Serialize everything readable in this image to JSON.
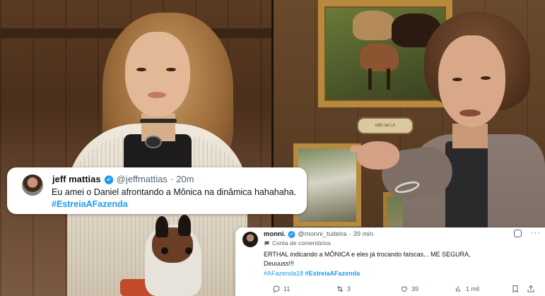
{
  "tweet_primary": {
    "display_name": "jeff mattias",
    "handle": "@jeffmattias",
    "separator": "·",
    "time": "20m",
    "text": "Eu amei o Daniel afrontando a Mônica na dinâmica hahahaha.",
    "hashtag": "#EstreiaAFazenda",
    "verified_color": "#1d9bf0"
  },
  "tweet_secondary": {
    "display_name": "monni.",
    "handle": "@monni_tuiteira",
    "separator": "·",
    "time": "39 min",
    "community_label": "Conta de comentários",
    "text_line1": "ERTHAL indicando a MÔNICA e eles já trocando faíscas... ME SEGURA,",
    "text_line2": "Deuuuss!!!",
    "hashtag1": "#AFazenda18",
    "hashtag2": "#EstreiaAFazenda",
    "actions": {
      "replies": "11",
      "retweets": "3",
      "likes": "39",
      "views": "1 mil"
    },
    "more_label": "···",
    "link_color": "#1d9bf0"
  },
  "scene": {
    "plaque_text": "NÃO SEI LÁ"
  }
}
